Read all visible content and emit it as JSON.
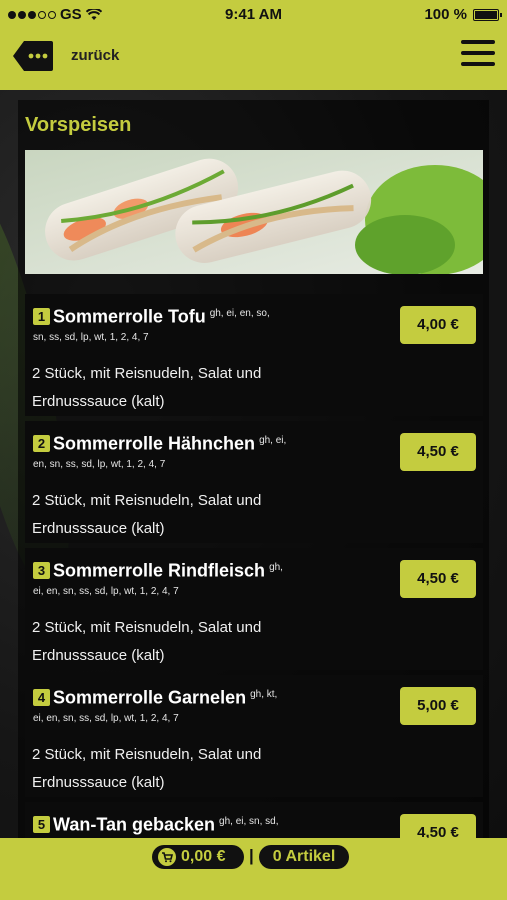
{
  "status_bar": {
    "carrier": "GS",
    "time": "9:41 AM",
    "battery": "100 %",
    "battery_level": 1.0
  },
  "nav": {
    "back_label": "zurück",
    "back_icon": "ellipsis-tag-icon",
    "menu_icon": "hamburger-menu-icon"
  },
  "section": {
    "title": "Vorspeisen"
  },
  "items": [
    {
      "number": "1",
      "name": "Sommerrolle Tofu",
      "allergens_line1": "gh, ei, en, so,",
      "allergens_line2": "sn, ss, sd, lp, wt, 1, 2, 4, 7",
      "description": "2 Stück, mit Reisnudeln, Salat und Erdnusssauce (kalt)",
      "price": "4,00 €"
    },
    {
      "number": "2",
      "name": "Sommerrolle Hähnchen",
      "allergens_line1": "gh, ei,",
      "allergens_line2": "en, sn, ss, sd, lp, wt, 1, 2, 4, 7",
      "description": "2 Stück, mit Reisnudeln, Salat und Erdnusssauce (kalt)",
      "price": "4,50 €"
    },
    {
      "number": "3",
      "name": "Sommerrolle Rindfleisch",
      "allergens_line1": "gh,",
      "allergens_line2": "ei, en, sn, ss, sd, lp, wt, 1, 2, 4, 7",
      "description": "2 Stück, mit Reisnudeln, Salat und Erdnusssauce (kalt)",
      "price": "4,50 €"
    },
    {
      "number": "4",
      "name": "Sommerrolle Garnelen",
      "allergens_line1": "gh, kt,",
      "allergens_line2": "ei, en, sn, ss, sd, lp, wt, 1, 2, 4, 7",
      "description": "2 Stück, mit Reisnudeln, Salat und Erdnusssauce (kalt)",
      "price": "5,00 €"
    },
    {
      "number": "5",
      "name": "Wan-Tan gebacken",
      "allergens_line1": "gh, ei, sn, sd,",
      "allergens_line2": "",
      "description": "",
      "price": "4,50 €"
    }
  ],
  "cart": {
    "total": "0,00 €",
    "separator": "|",
    "count": "0 Artikel",
    "cart_icon": "cart-icon"
  },
  "colors": {
    "accent": "#c4cc3f",
    "background": "#1a1a1a",
    "text": "#ffffff"
  }
}
